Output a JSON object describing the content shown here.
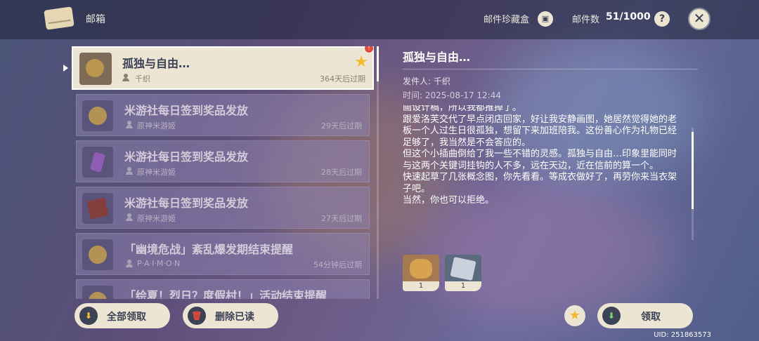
{
  "header": {
    "title": "邮箱",
    "collection_label": "邮件珍藏盒",
    "count_label": "邮件数",
    "count_value": "51/1000",
    "help_icon": "?",
    "close_icon": "✕"
  },
  "mail_list": [
    {
      "title": "孤独与自由…",
      "sender": "千织",
      "expires": "364天后过期",
      "selected": true,
      "starred": true,
      "unread": true,
      "icon": "food-dish-icon"
    },
    {
      "title": "米游社每日签到奖品发放",
      "sender": "原神米游姬",
      "expires": "29天后过期",
      "icon": "mora-coin-icon"
    },
    {
      "title": "米游社每日签到奖品发放",
      "sender": "原神米游姬",
      "expires": "28天后过期",
      "icon": "crystal-icon"
    },
    {
      "title": "米游社每日签到奖品发放",
      "sender": "原神米游姬",
      "expires": "27天后过期",
      "icon": "book-icon"
    },
    {
      "title": "「幽境危战」紊乱爆发期结束提醒",
      "sender": "P·A·I·M·O·N",
      "expires": "54分钟后过期",
      "icon": "mora-coin-icon"
    },
    {
      "title": "「绘夏！烈日？度假村！」活动结束提醒",
      "sender": "",
      "expires": "",
      "icon": "mora-coin-icon"
    }
  ],
  "detail": {
    "title": "孤独与自由…",
    "sender": "发件人: 千织",
    "time": "时间: 2025-08-17 12:44",
    "body": [
      "画设计稿，所以我都推掉了。",
      "跟爱洛芙交代了早点闭店回家，好让我安静画图，她居然觉得她的老板一个人过生日很孤独，想留下来加班陪我。这份善心作为礼物已经足够了，我当然是不会答应的。",
      "但这个小插曲倒给了我一些不错的灵感。孤独与自由…印象里能同时与这两个关键词挂钩的人不多，远在天边，近在信前的算一个。",
      "快速起草了几张概念图，你先看看。等成衣做好了，再劳你来当衣架子吧。",
      "当然，你也可以拒绝。"
    ],
    "attachments": [
      {
        "icon": "food-dish-icon",
        "count": "1"
      },
      {
        "icon": "blueprint-icon",
        "count": "1"
      }
    ]
  },
  "footer": {
    "claim_all": "全部领取",
    "delete_read": "删除已读",
    "claim": "领取",
    "uid": "UID: 251863573"
  },
  "colors": {
    "panel": "#ece5d3",
    "dark": "#3b4256",
    "star": "#f1b92e",
    "badge": "#e24a3c"
  }
}
